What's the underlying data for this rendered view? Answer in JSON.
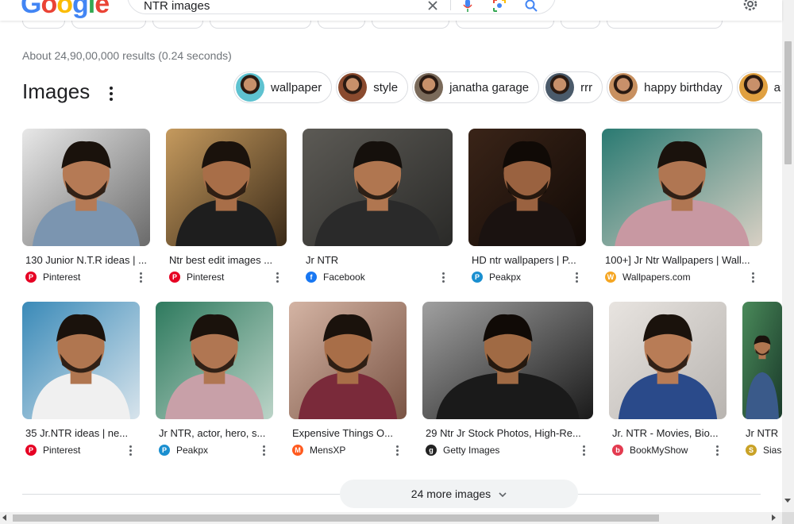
{
  "header": {
    "logo_letters": [
      {
        "ch": "G",
        "color": "#4285F4"
      },
      {
        "ch": "o",
        "color": "#EA4335"
      },
      {
        "ch": "o",
        "color": "#FBBC05"
      },
      {
        "ch": "g",
        "color": "#4285F4"
      },
      {
        "ch": "l",
        "color": "#34A853"
      },
      {
        "ch": "e",
        "color": "#EA4335"
      }
    ],
    "search_query": "NTR images"
  },
  "result_stats": "About 24,90,00,000 results (0.24 seconds)",
  "images_section": {
    "title": "Images",
    "related_chips": [
      {
        "label": "wallpaper",
        "thumb_color": "#5ec2d0"
      },
      {
        "label": "style",
        "thumb_color": "#8a4a2e"
      },
      {
        "label": "janatha garage",
        "thumb_color": "#7a6a5a"
      },
      {
        "label": "rrr",
        "thumb_color": "#4a5a6a"
      },
      {
        "label": "happy birthday",
        "thumb_color": "#c89060"
      },
      {
        "label": "aravinda sametha",
        "thumb_color": "#e0a040"
      }
    ],
    "row1": [
      {
        "caption": "130 Junior N.T.R ideas | ...",
        "source": "Pinterest",
        "favicon": "pinterest-icon",
        "fav_color": "#E60023"
      },
      {
        "caption": "Ntr best edit images ...",
        "source": "Pinterest",
        "favicon": "pinterest-icon",
        "fav_color": "#E60023"
      },
      {
        "caption": "Jr NTR",
        "source": "Facebook",
        "favicon": "facebook-icon",
        "fav_color": "#1877F2"
      },
      {
        "caption": "HD ntr wallpapers | P...",
        "source": "Peakpx",
        "favicon": "peakpx-icon",
        "fav_color": "#1a8fd0"
      },
      {
        "caption": "100+] Jr Ntr Wallpapers | Wall...",
        "source": "Wallpapers.com",
        "favicon": "wallpapers-com-icon",
        "fav_color": "#f5a623"
      }
    ],
    "row2": [
      {
        "caption": "35 Jr.NTR ideas | ne...",
        "source": "Pinterest",
        "favicon": "pinterest-icon",
        "fav_color": "#E60023"
      },
      {
        "caption": "Jr NTR, actor, hero, s...",
        "source": "Peakpx",
        "favicon": "peakpx-icon",
        "fav_color": "#1a8fd0"
      },
      {
        "caption": "Expensive Things O...",
        "source": "MensXP",
        "favicon": "mensxp-icon",
        "fav_color": "#ff5a1f"
      },
      {
        "caption": "29 Ntr Jr Stock Photos, High-Re...",
        "source": "Getty Images",
        "favicon": "getty-images-icon",
        "fav_color": "#222222"
      },
      {
        "caption": "Jr. NTR - Movies, Bio...",
        "source": "BookMyShow",
        "favicon": "bookmyshow-icon",
        "fav_color": "#e33b50"
      },
      {
        "caption": "Jr NTR",
        "source": "Siasat",
        "favicon": "siasat-icon",
        "fav_color": "#c9a227"
      }
    ],
    "more_button": "24 more images"
  }
}
